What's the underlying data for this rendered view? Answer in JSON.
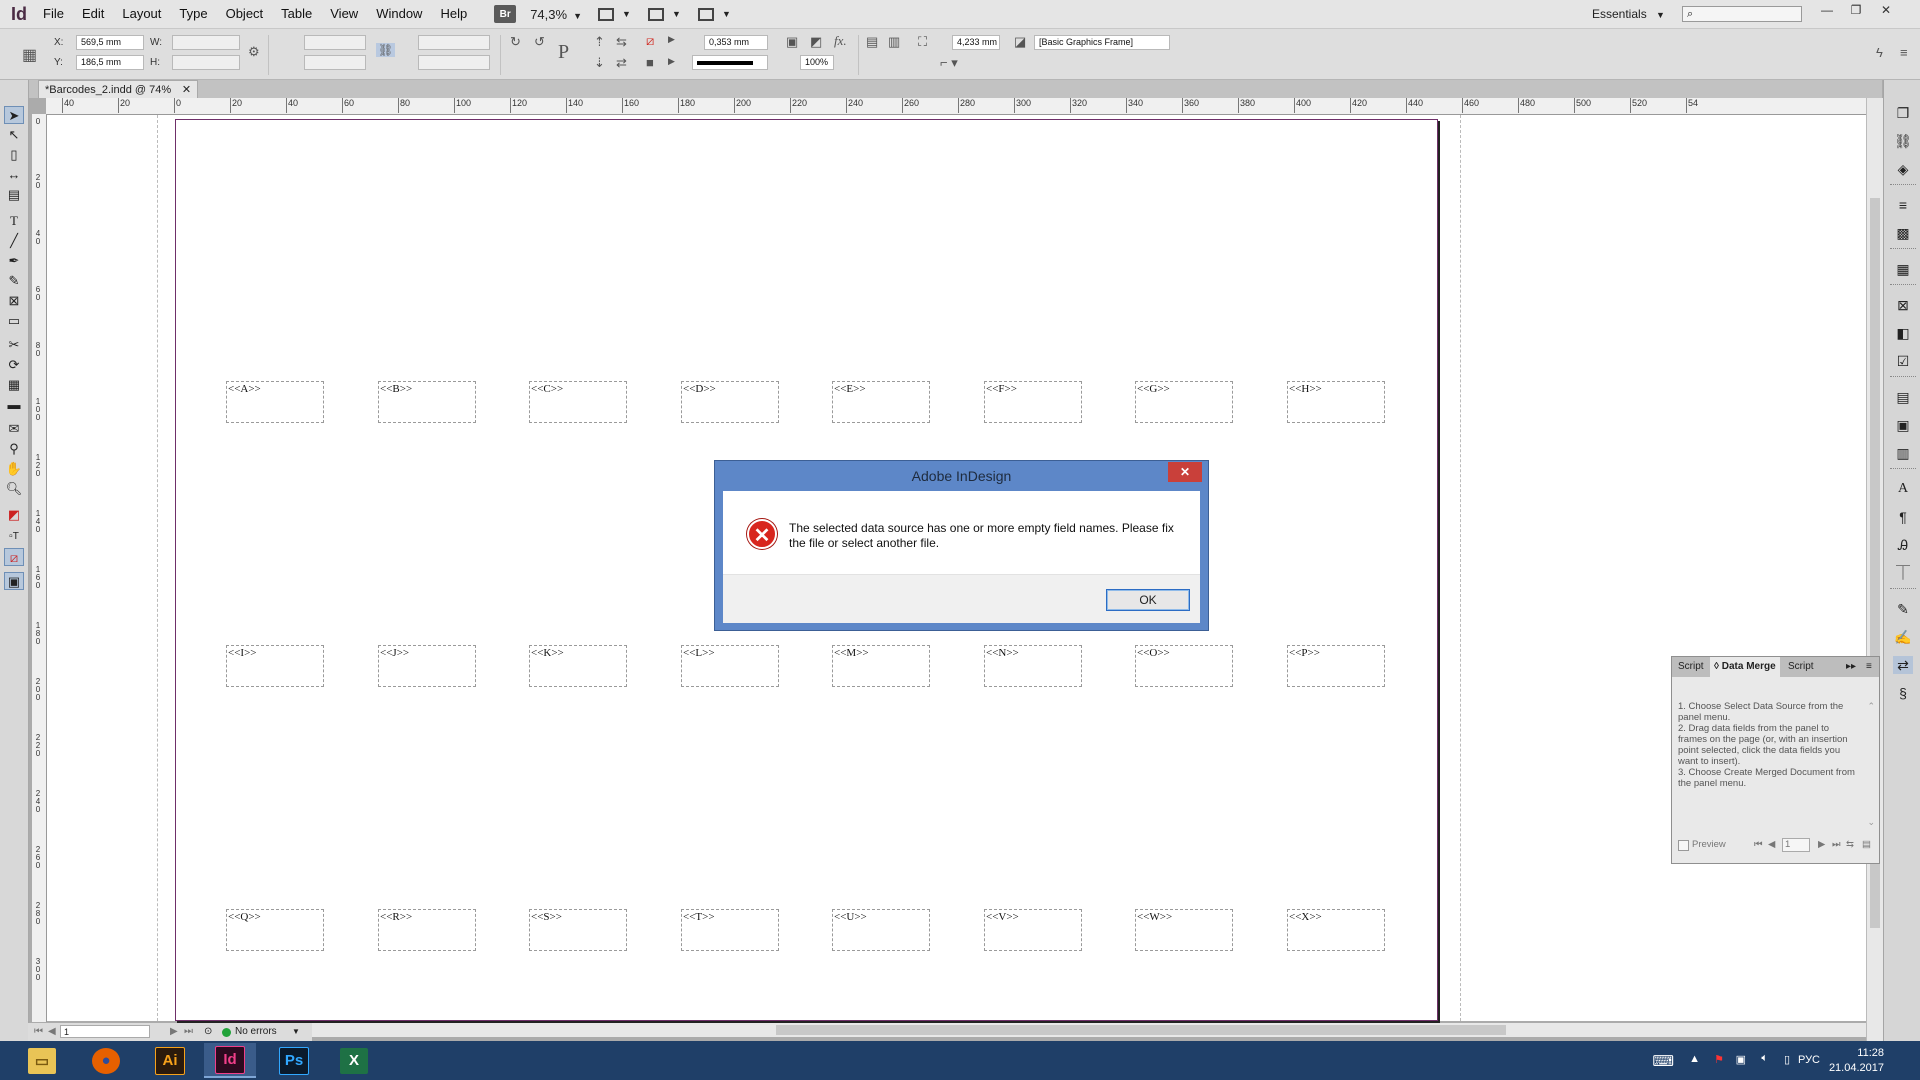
{
  "app": {
    "logo": "Id",
    "menu": [
      "File",
      "Edit",
      "Layout",
      "Type",
      "Object",
      "Table",
      "View",
      "Window",
      "Help"
    ],
    "bridge_label": "Br",
    "zoom": "74,3%",
    "workspace": "Essentials",
    "search_placeholder": ""
  },
  "controlbar": {
    "x_label": "X:",
    "x_value": "569,5 mm",
    "y_label": "Y:",
    "y_value": "186,5 mm",
    "w_label": "W:",
    "h_label": "H:",
    "stroke_weight": "0,353 mm",
    "opacity": "100%",
    "fitting_value": "4,233 mm",
    "object_style": "[Basic Graphics Frame]"
  },
  "document": {
    "tab_title": "*Barcodes_2.indd @ 74%",
    "ruler_h": [
      "40",
      "20",
      "0",
      "20",
      "40",
      "60",
      "80",
      "100",
      "120",
      "140",
      "160",
      "180",
      "200",
      "220",
      "240",
      "260",
      "280",
      "300",
      "320",
      "340",
      "360",
      "380",
      "400",
      "420",
      "440",
      "460",
      "480",
      "500",
      "520",
      "54"
    ],
    "ruler_v": [
      "0",
      "2\n0",
      "4\n0",
      "6\n0",
      "8\n0",
      "1\n0\n0",
      "1\n2\n0",
      "1\n4\n0",
      "1\n6\n0",
      "1\n8\n0",
      "2\n0\n0",
      "2\n2\n0",
      "2\n4\n0",
      "2\n6\n0",
      "2\n8\n0",
      "3\n0\n0"
    ],
    "field_rows": [
      [
        "<<A>>",
        "<<B>>",
        "<<C>>",
        "<<D>>",
        "<<E>>",
        "<<F>>",
        "<<G>>",
        "<<H>>"
      ],
      [
        "<<I>>",
        "<<J>>",
        "<<K>>",
        "<<L>>",
        "<<M>>",
        "<<N>>",
        "<<O>>",
        "<<P>>"
      ],
      [
        "<<Q>>",
        "<<R>>",
        "<<S>>",
        "<<T>>",
        "<<U>>",
        "<<V>>",
        "<<W>>",
        "<<X>>"
      ]
    ]
  },
  "status": {
    "page": "1",
    "preflight": "No errors"
  },
  "dialog": {
    "title": "Adobe InDesign",
    "close": "✕",
    "message": "The selected data source has one or more empty field names. Please fix the file or select another file.",
    "ok_label": "OK"
  },
  "data_merge_panel": {
    "tabs": [
      "Script",
      "Data Merge",
      "Script"
    ],
    "instructions": "1. Choose Select Data Source from the panel menu.\n2. Drag data fields from the panel to frames on the page (or, with an insertion point selected, click the data fields you want to insert).\n3. Choose Create Merged Document from the panel menu.",
    "preview_label": "Preview",
    "record": "1"
  },
  "taskbar": {
    "apps": [
      {
        "name": "File Explorer",
        "glyph": "▭"
      },
      {
        "name": "Firefox",
        "glyph": "●"
      },
      {
        "name": "Illustrator",
        "glyph": "Ai"
      },
      {
        "name": "InDesign",
        "glyph": "Id"
      },
      {
        "name": "Photoshop",
        "glyph": "Ps"
      },
      {
        "name": "Excel",
        "glyph": "X"
      }
    ],
    "language": "РУС",
    "time": "11:28",
    "date": "21.04.2017"
  },
  "colors": {
    "dialog_frame": "#5d87c8",
    "error_red": "#d8261e",
    "page_border": "#6f2f69",
    "taskbar": "#1f3f68"
  }
}
